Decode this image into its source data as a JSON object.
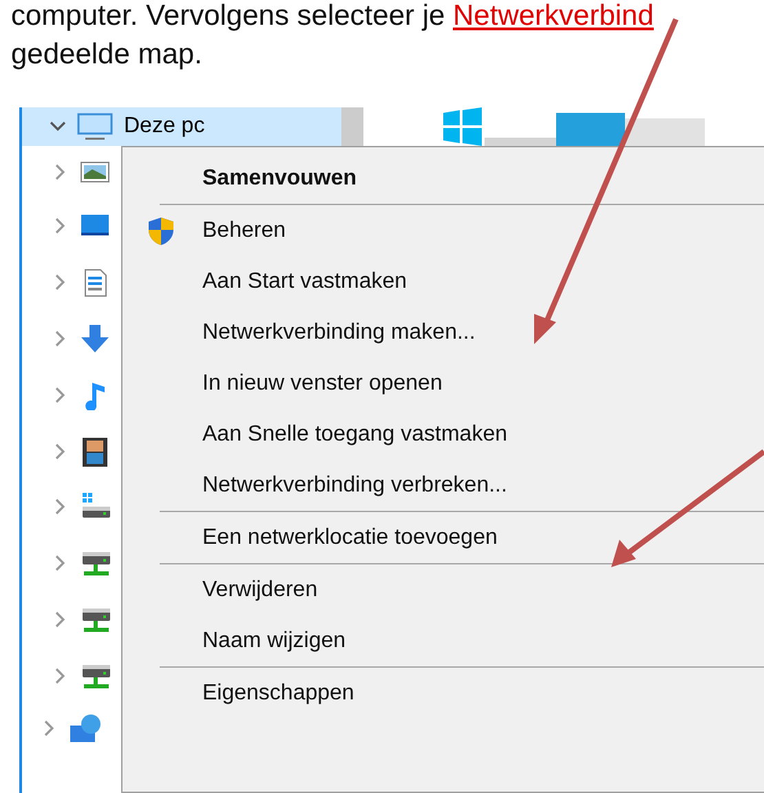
{
  "document": {
    "lines": [
      {
        "text": "computer. Vervolgens selecteer je ",
        "link": "Netwerkverbind"
      },
      {
        "text": "gedeelde map."
      }
    ]
  },
  "explorer": {
    "tree": [
      {
        "label": "Deze pc",
        "expanded": true,
        "selected": true,
        "children": [
          {
            "expanded": false
          },
          {
            "expanded": false
          },
          {
            "expanded": false
          },
          {
            "expanded": false
          },
          {
            "expanded": false
          },
          {
            "expanded": false
          },
          {
            "expanded": false
          },
          {
            "expanded": false
          },
          {
            "expanded": false
          },
          {
            "expanded": false
          }
        ]
      },
      {
        "expanded": false,
        "selected": false
      }
    ]
  },
  "context_menu": {
    "items": [
      {
        "kind": "item",
        "label": "Samenvouwen",
        "default": true
      },
      {
        "kind": "separator"
      },
      {
        "kind": "item",
        "label": "Beheren",
        "admin": true
      },
      {
        "kind": "item",
        "label": "Aan Start vastmaken"
      },
      {
        "kind": "item",
        "label": "Netwerkverbinding maken..."
      },
      {
        "kind": "item",
        "label": "In nieuw venster openen"
      },
      {
        "kind": "item",
        "label": "Aan Snelle toegang vastmaken"
      },
      {
        "kind": "item",
        "label": "Netwerkverbinding verbreken..."
      },
      {
        "kind": "separator"
      },
      {
        "kind": "item",
        "label": "Een netwerklocatie toevoegen"
      },
      {
        "kind": "separator"
      },
      {
        "kind": "item",
        "label": "Verwijderen"
      },
      {
        "kind": "item",
        "label": "Naam wijzigen"
      },
      {
        "kind": "separator"
      },
      {
        "kind": "item",
        "label": "Eigenschappen"
      }
    ]
  }
}
